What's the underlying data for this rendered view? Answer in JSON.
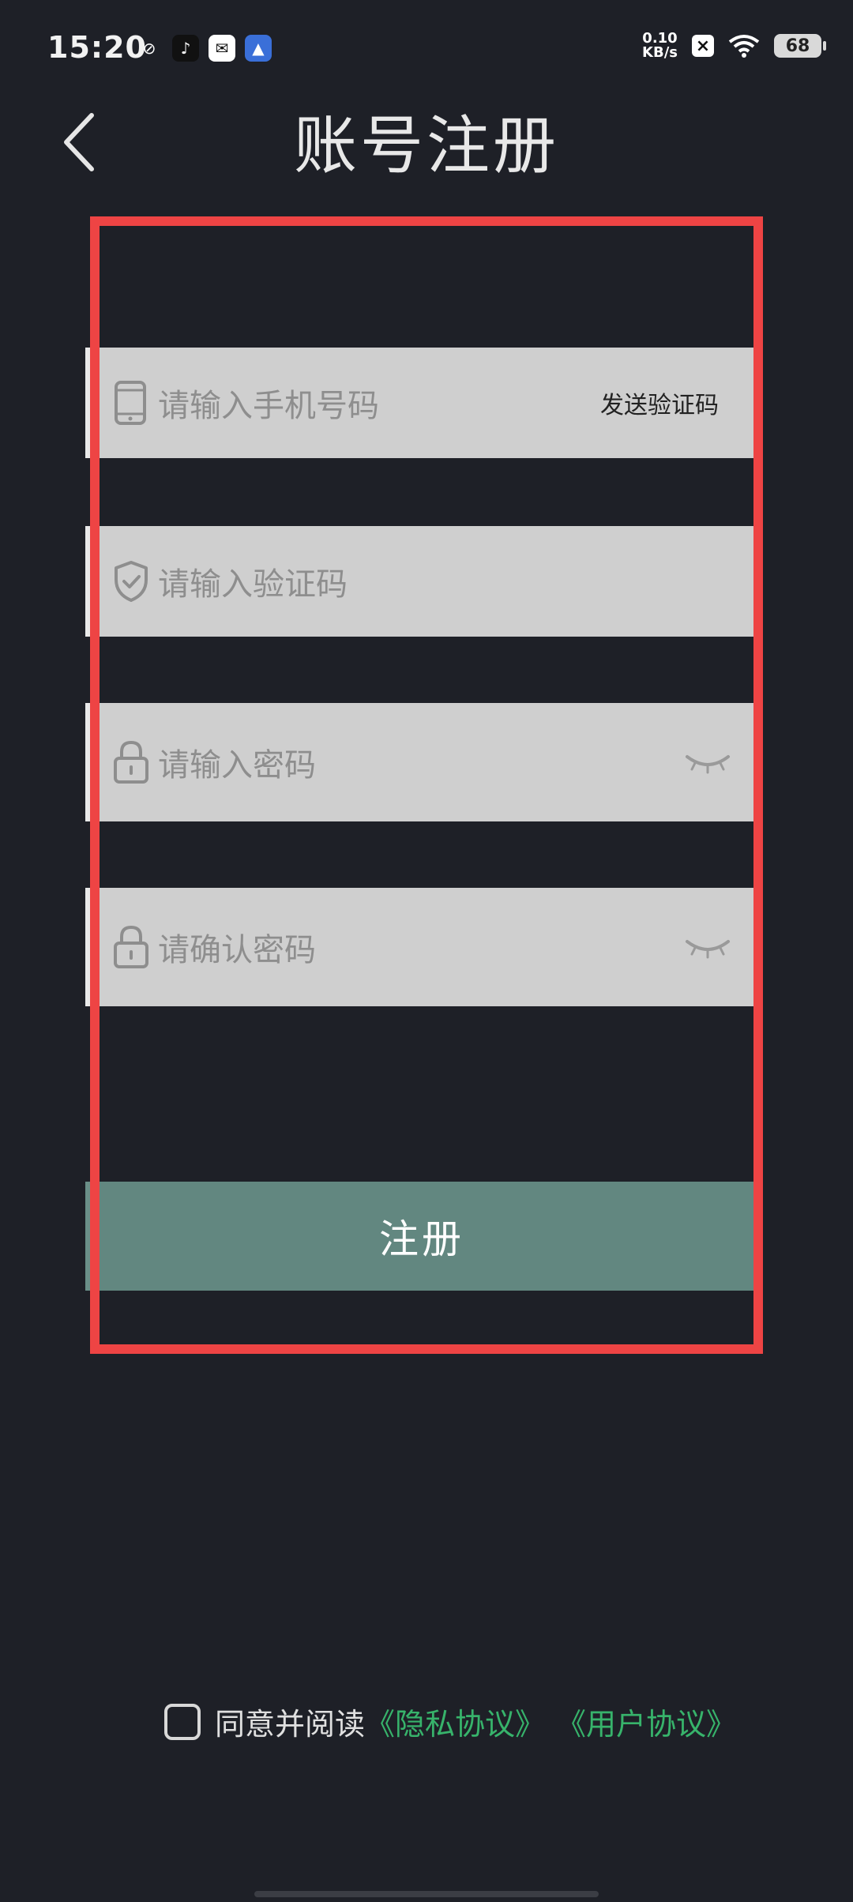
{
  "status_bar": {
    "time": "15:20",
    "speed_value": "0.10",
    "speed_unit": "KB/s",
    "battery": "68"
  },
  "header": {
    "title": "账号注册"
  },
  "form": {
    "phone_placeholder": "请输入手机号码",
    "send_code_label": "发送验证码",
    "code_placeholder": "请输入验证码",
    "password_placeholder": "请输入密码",
    "confirm_placeholder": "请确认密码",
    "register_label": "注册"
  },
  "agreement": {
    "prefix": "同意并阅读",
    "privacy_link": "《隐私协议》",
    "user_link": "《用户协议》"
  },
  "colors": {
    "background": "#1e2027",
    "field_bg": "#cfcfcf",
    "button_bg": "#628780",
    "link": "#37b36b",
    "highlight": "#ee4444"
  }
}
